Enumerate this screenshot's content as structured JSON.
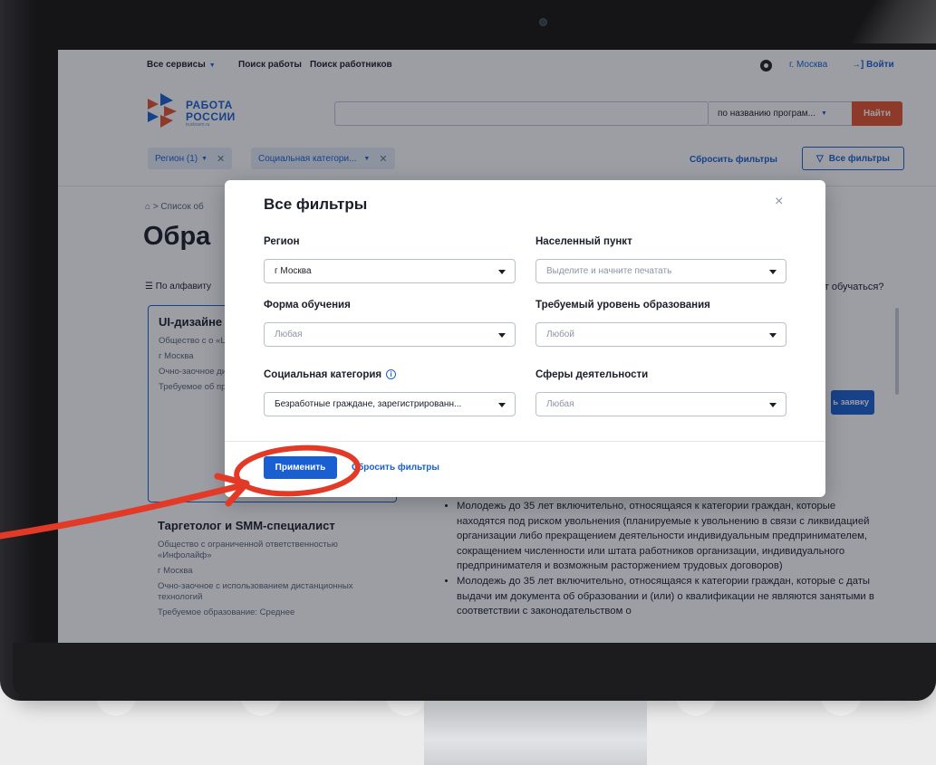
{
  "topnav": {
    "all_services": "Все сервисы",
    "job_search": "Поиск работы",
    "worker_search": "Поиск работников",
    "city": "г. Москва",
    "login": "Войти"
  },
  "logo": {
    "line1": "РАБОТА",
    "line2": "РОССИИ",
    "line3": "trudvsem.ru"
  },
  "search": {
    "value": "",
    "mode": "по названию програм...",
    "find": "Найти"
  },
  "chips": [
    {
      "label": "Регион (1)"
    },
    {
      "label": "Социальная категори..."
    }
  ],
  "filters": {
    "reset": "Сбросить фильтры",
    "all": "Все фильтры"
  },
  "breadcrumb": "⌂  >  Список об",
  "page_title": "Обра",
  "sort_label": "По алфавиту",
  "learn_question": "ет обучаться?",
  "cards": [
    {
      "title": "UI-дизайне дизайнера",
      "lines": [
        "Общество с о «Центральна профессиона",
        "г Москва",
        "Очно-заочное дистанционн",
        "Требуемое об профессиона"
      ]
    },
    {
      "title": "Таргетолог и SMM-специалист",
      "lines": [
        "Общество с ограниченной ответственностью «Инфолайф»",
        "г Москва",
        "Очно-заочное с использованием дистанционных технологий",
        "Требуемое образование: Среднее"
      ]
    }
  ],
  "right_button": "ь заявку",
  "bullets": [
    "Молодежь до 35 лет включительно, относящаяся к категории граждан, которые находятся под риском увольнения (планируемые к увольнению в связи с ликвидацией организации либо прекращением деятельности индивидуальным предпринимателем, сокращением численности или штата работников организации, индивидуального предпринимателя и возможным расторжением трудовых договоров)",
    "Молодежь до 35 лет включительно, относящаяся к категории граждан, которые с даты выдачи им документа об образовании и (или) о квалификации не являются занятыми в соответствии с законодательством о"
  ],
  "modal": {
    "title": "Все фильтры",
    "close": "×",
    "region_label": "Регион",
    "region_value": "г Москва",
    "locality_label": "Населенный пункт",
    "locality_placeholder": "Выделите и начните печатать",
    "form_label": "Форма обучения",
    "form_value": "Любая",
    "edu_label": "Требуемый уровень образования",
    "edu_value": "Любой",
    "social_label": "Социальная категория",
    "social_value": "Безработные граждане, зарегистрированн...",
    "sphere_label": "Сферы деятельности",
    "sphere_value": "Любая",
    "apply": "Применить",
    "reset": "Сбросить фильтры"
  },
  "colors": {
    "accent": "#1a5fd1",
    "find_button": "#e5532d",
    "annotation": "#e23a26"
  }
}
